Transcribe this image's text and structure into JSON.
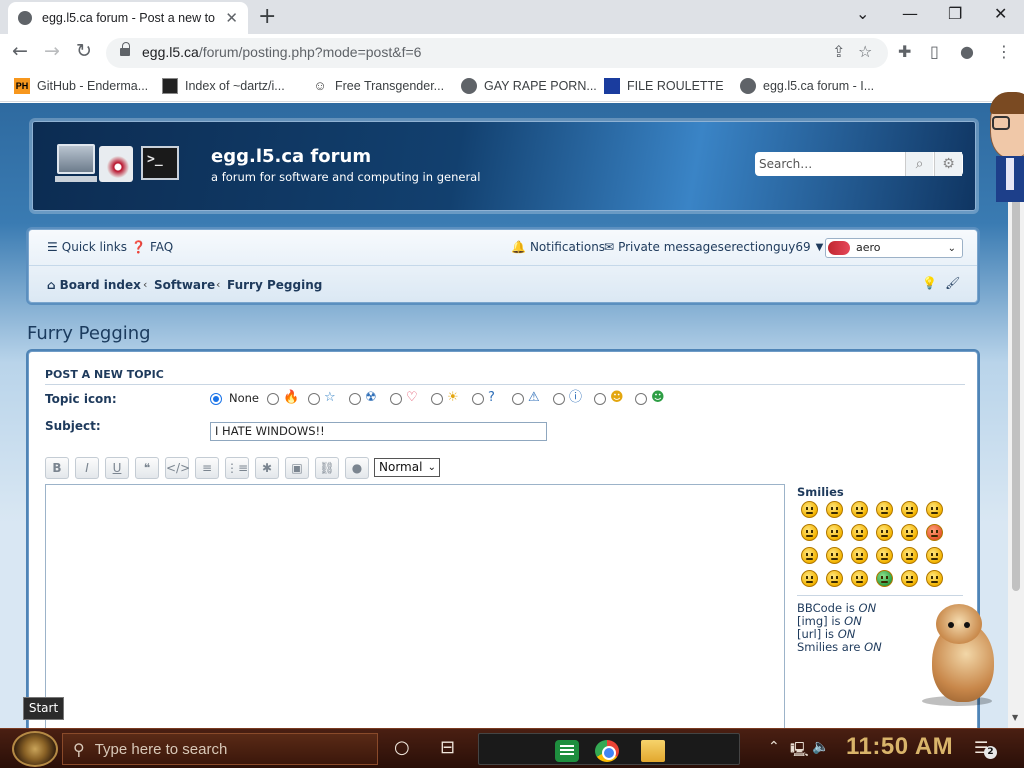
{
  "browser": {
    "tab_title": "egg.l5.ca forum - Post a new to",
    "url_host": "egg.l5.ca",
    "url_path": "/forum/posting.php?mode=post&f=6",
    "bookmarks": [
      {
        "label": "GitHub - Enderma...",
        "icon": "ph-icon",
        "icon_text": "PH"
      },
      {
        "label": "Index of ~dartz/i...",
        "icon": "index-icon"
      },
      {
        "label": "Free Transgender...",
        "icon": "mask-icon"
      },
      {
        "label": "GAY RAPE PORN...",
        "icon": "globe-icon"
      },
      {
        "label": "FILE ROULETTE",
        "icon": "file-roulette-icon"
      },
      {
        "label": "egg.l5.ca forum - I...",
        "icon": "globe-icon"
      }
    ]
  },
  "header": {
    "site_title": "egg.l5.ca forum",
    "site_description": "a forum for software and computing in general",
    "search_placeholder": "Search…"
  },
  "navbar": {
    "quick_links": "Quick links",
    "faq": "FAQ",
    "notifications": "Notifications",
    "private_messages": "Private messages",
    "username": "erectionguy69",
    "style_value": "aero",
    "breadcrumbs": [
      "Board index",
      "Software",
      "Furry Pegging"
    ]
  },
  "topic": {
    "title": "Furry Pegging"
  },
  "form": {
    "panel_heading": "POST A NEW TOPIC",
    "topic_icon_label": "Topic icon:",
    "topic_icon_none": "None",
    "topic_icons": [
      "fire-icon",
      "star-icon",
      "radioactive-icon",
      "heart-icon",
      "sun-icon",
      "question-icon",
      "warning-icon",
      "info-icon",
      "wink-icon",
      "alien-icon"
    ],
    "subject_label": "Subject:",
    "subject_value": "I HATE WINDOWS!!",
    "format_buttons": [
      {
        "name": "bold-button",
        "glyph": "B"
      },
      {
        "name": "italic-button",
        "glyph": "I"
      },
      {
        "name": "underline-button",
        "glyph": "U"
      },
      {
        "name": "quote-button",
        "glyph": "❝"
      },
      {
        "name": "code-button",
        "glyph": "</>"
      },
      {
        "name": "list-button",
        "glyph": "≡"
      },
      {
        "name": "ordered-list-button",
        "glyph": "⋮≡"
      },
      {
        "name": "list-item-button",
        "glyph": "✱"
      },
      {
        "name": "image-button",
        "glyph": "▣"
      },
      {
        "name": "link-button",
        "glyph": "⛓"
      },
      {
        "name": "color-button",
        "glyph": "●"
      }
    ],
    "font_size_value": "Normal",
    "smilies_label": "Smilies",
    "smilies_count": 24,
    "options": {
      "bbcode_label": "BBCode is",
      "bbcode_state": "ON",
      "img_label": "[img] is",
      "img_state": "ON",
      "url_label": "[url] is",
      "url_state": "ON",
      "smilies_label": "Smilies are",
      "smilies_state": "ON"
    }
  },
  "overlay": {
    "start_tooltip": "Start"
  },
  "taskbar": {
    "search_placeholder": "Type here to search",
    "clock": "11:50 AM",
    "notification_count": "2"
  }
}
